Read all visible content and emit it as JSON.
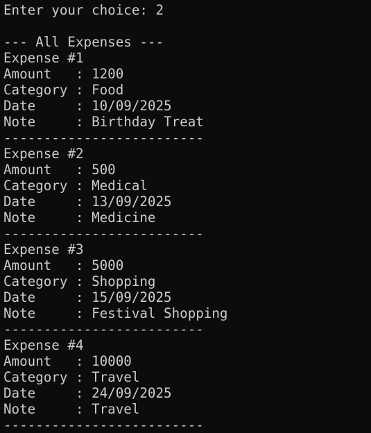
{
  "prompt_line": "Enter your choice: 2",
  "blank_line": "",
  "header": "--- All Expenses ---",
  "separator": "-------------------------",
  "expenses": [
    {
      "title": "Expense #1",
      "amount_line": "Amount   : 1200",
      "category_line": "Category : Food",
      "date_line": "Date     : 10/09/2025",
      "note_line": "Note     : Birthday Treat"
    },
    {
      "title": "Expense #2",
      "amount_line": "Amount   : 500",
      "category_line": "Category : Medical",
      "date_line": "Date     : 13/09/2025",
      "note_line": "Note     : Medicine"
    },
    {
      "title": "Expense #3",
      "amount_line": "Amount   : 5000",
      "category_line": "Category : Shopping",
      "date_line": "Date     : 15/09/2025",
      "note_line": "Note     : Festival Shopping"
    },
    {
      "title": "Expense #4",
      "amount_line": "Amount   : 10000",
      "category_line": "Category : Travel",
      "date_line": "Date     : 24/09/2025",
      "note_line": "Note     : Travel"
    }
  ],
  "colors": {
    "background": "#0c0c0c",
    "text": "#cccccc"
  }
}
